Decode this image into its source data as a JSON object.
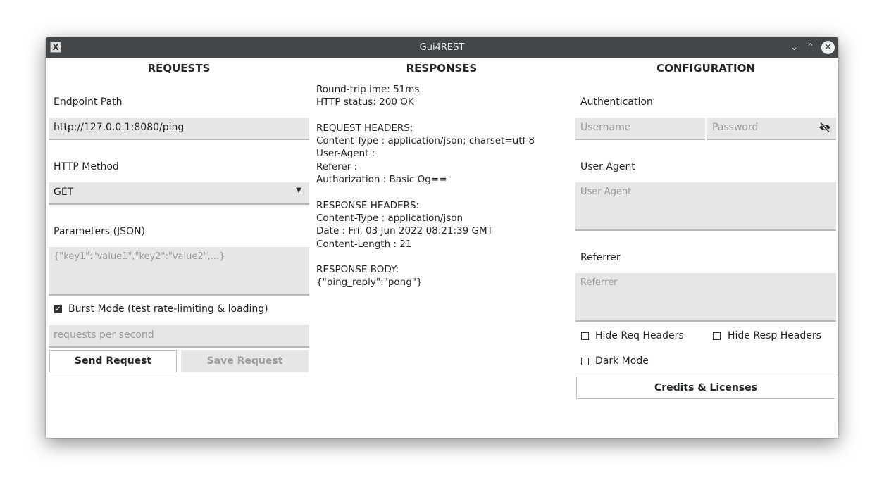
{
  "window": {
    "title": "Gui4REST",
    "app_icon": "X11-app-icon"
  },
  "requests": {
    "heading": "REQUESTS",
    "endpoint_label": "Endpoint Path",
    "endpoint_value": "http://127.0.0.1:8080/ping",
    "method_label": "HTTP Method",
    "method_value": "GET",
    "params_label": "Parameters (JSON)",
    "params_placeholder": "{\"key1\":\"value1\",\"key2\":\"value2\",...}",
    "burst_label": "Burst Mode (test rate-limiting & loading)",
    "burst_checked": true,
    "rps_placeholder": "requests per second",
    "send_label": "Send Request",
    "save_label": "Save Request"
  },
  "responses": {
    "heading": "RESPONSES",
    "lines": [
      "Round-trip ime: 51ms",
      "HTTP status: 200 OK",
      "",
      "REQUEST HEADERS:",
      "Content-Type : application/json; charset=utf-8",
      "User-Agent :",
      "Referer :",
      "Authorization : Basic Og==",
      "",
      "RESPONSE HEADERS:",
      "Content-Type : application/json",
      "Date : Fri, 03 Jun 2022 08:21:39 GMT",
      "Content-Length : 21",
      "",
      "RESPONSE BODY:",
      "{\"ping_reply\":\"pong\"}"
    ]
  },
  "configuration": {
    "heading": "CONFIGURATION",
    "auth_label": "Authentication",
    "username_placeholder": "Username",
    "password_placeholder": "Password",
    "user_agent_label": "User Agent",
    "user_agent_placeholder": "User Agent",
    "referrer_label": "Referrer",
    "referrer_placeholder": "Referrer",
    "hide_req_label": "Hide Req Headers",
    "hide_resp_label": "Hide Resp Headers",
    "dark_mode_label": "Dark Mode",
    "credits_label": "Credits & Licenses"
  }
}
